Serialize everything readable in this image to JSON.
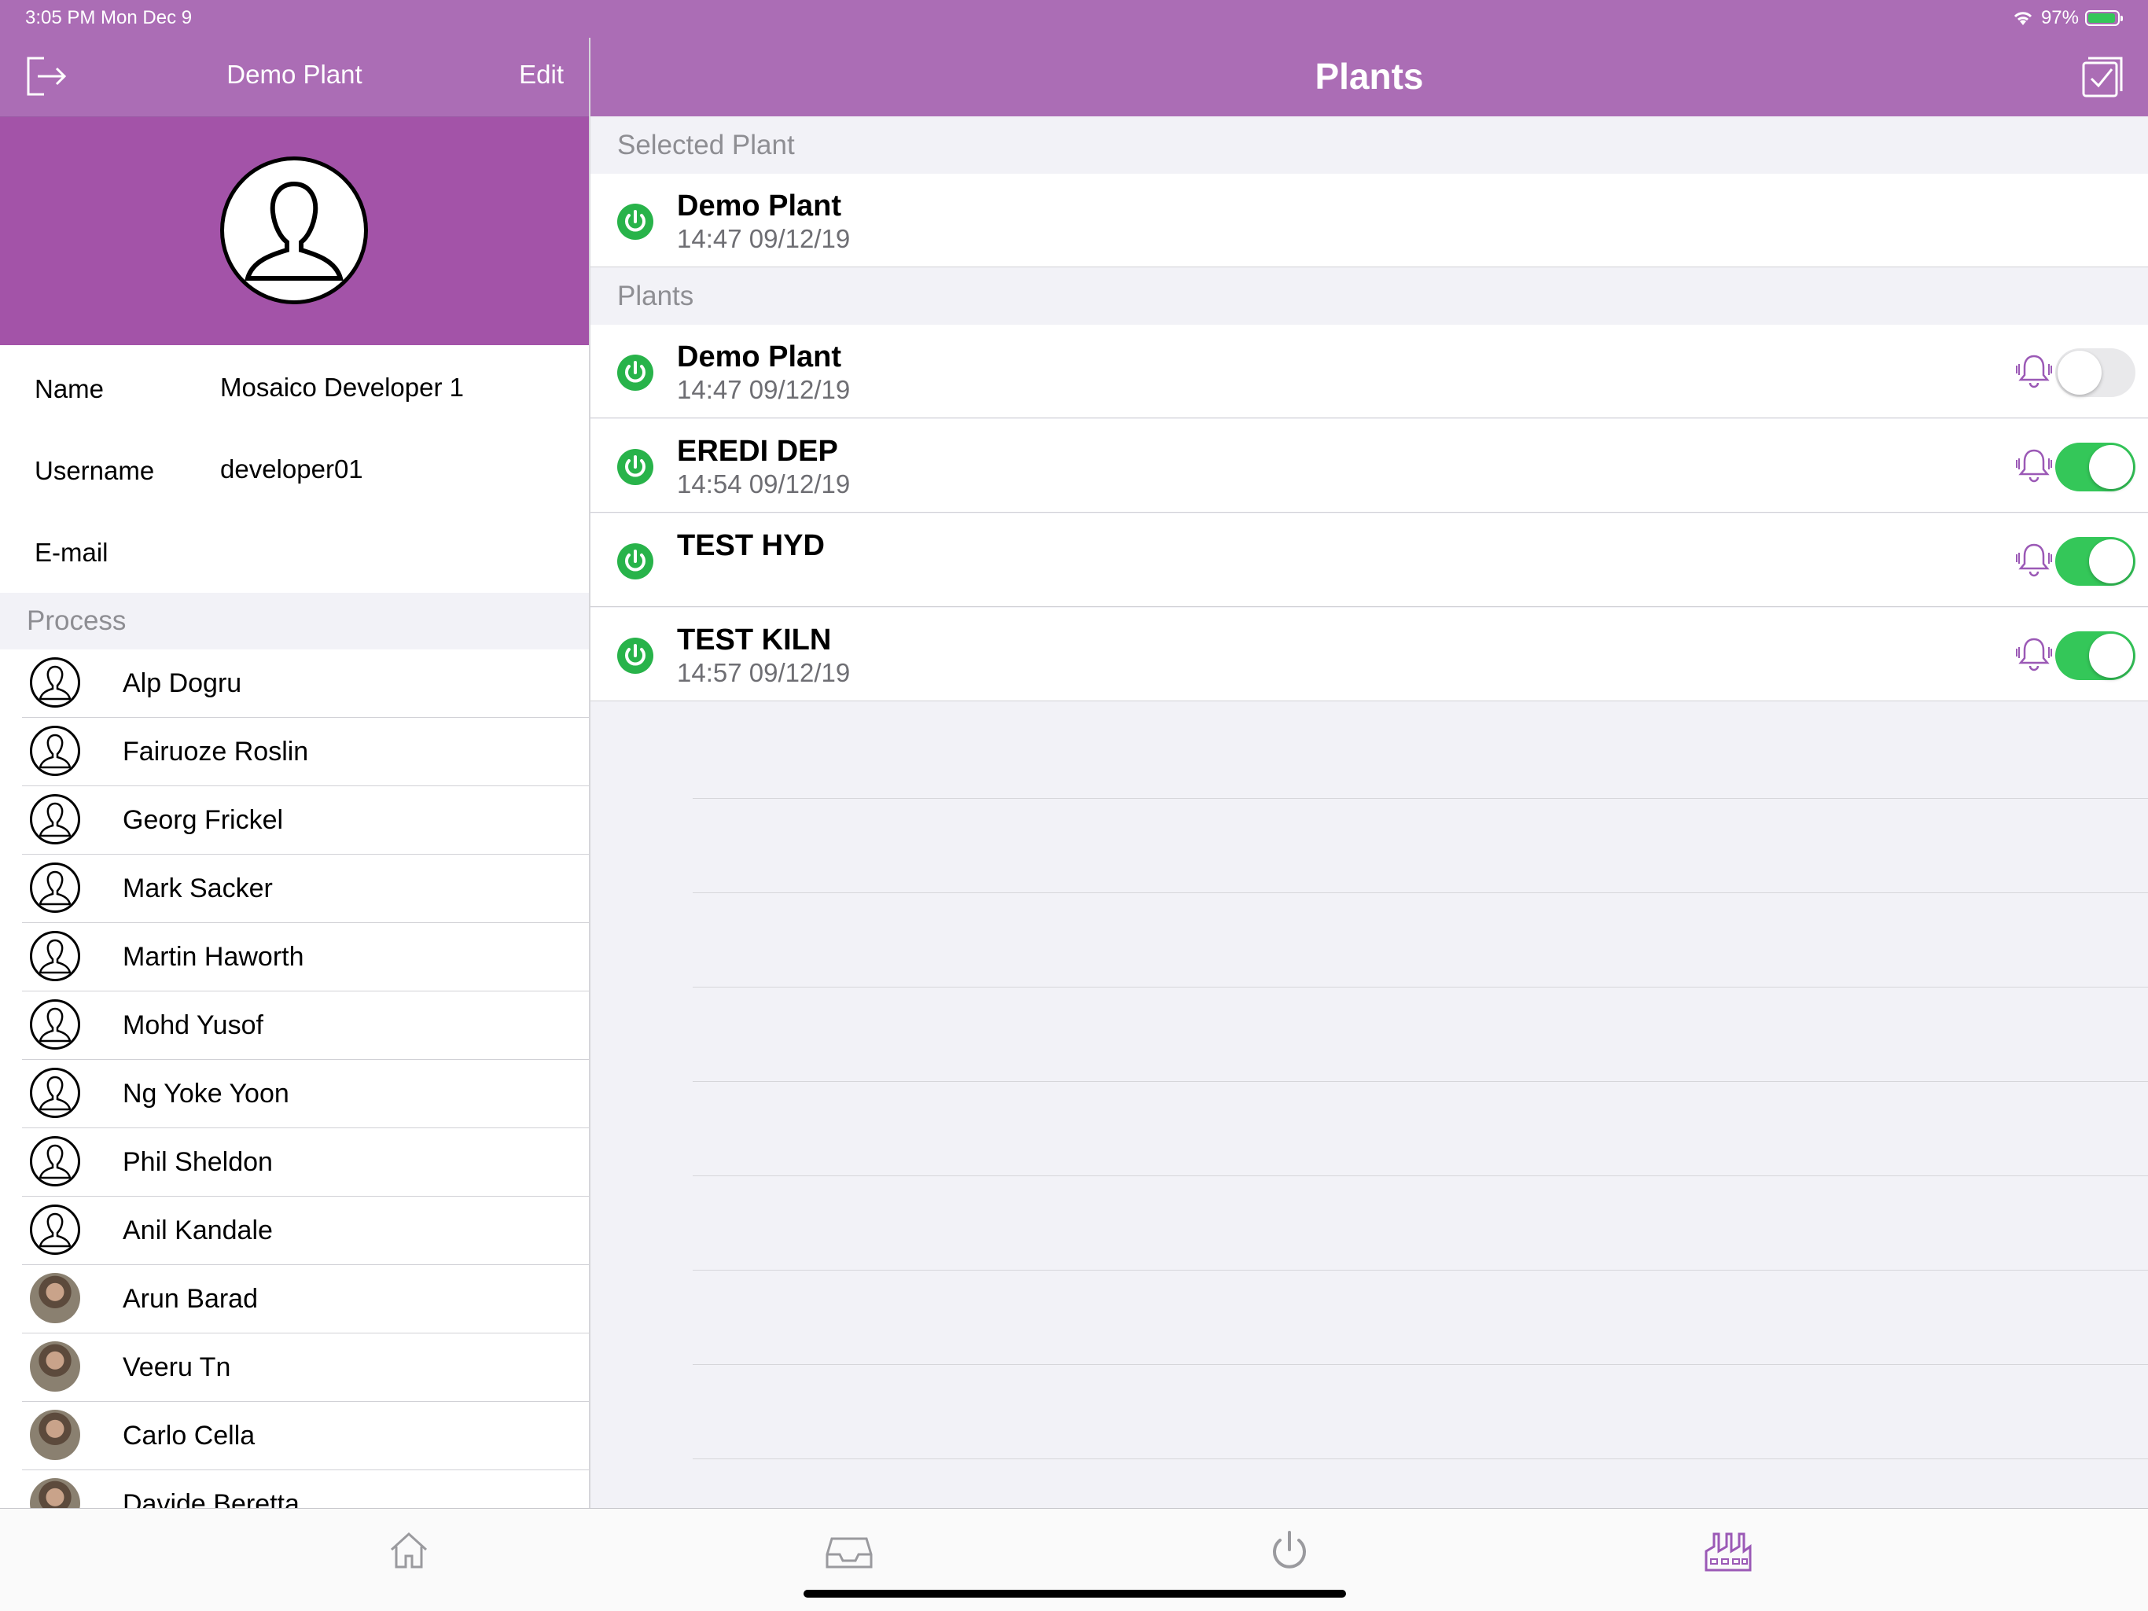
{
  "status_bar": {
    "time_date": "3:05 PM   Mon Dec 9",
    "battery": "97%"
  },
  "left_nav": {
    "title": "Demo Plant",
    "edit": "Edit"
  },
  "profile": {
    "name_label": "Name",
    "name_value": "Mosaico Developer 1",
    "username_label": "Username",
    "username_value": "developer01",
    "email_label": "E-mail",
    "email_value": ""
  },
  "process_header": "Process",
  "people": [
    {
      "name": "Alp Dogru",
      "avatar": "outline"
    },
    {
      "name": "Fairuoze Roslin",
      "avatar": "outline"
    },
    {
      "name": "Georg Frickel",
      "avatar": "outline"
    },
    {
      "name": "Mark Sacker",
      "avatar": "outline"
    },
    {
      "name": "Martin Haworth",
      "avatar": "outline"
    },
    {
      "name": "Mohd Yusof",
      "avatar": "outline"
    },
    {
      "name": "Ng Yoke Yoon",
      "avatar": "outline"
    },
    {
      "name": "Phil Sheldon",
      "avatar": "outline"
    },
    {
      "name": "Anil Kandale",
      "avatar": "outline"
    },
    {
      "name": "Arun Barad",
      "avatar": "photo"
    },
    {
      "name": "Veeru Tn",
      "avatar": "photo"
    },
    {
      "name": "Carlo Cella",
      "avatar": "photo"
    },
    {
      "name": "Davide Beretta",
      "avatar": "photo"
    }
  ],
  "right_nav": {
    "title": "Plants"
  },
  "selected_header": "Selected Plant",
  "selected_plant": {
    "name": "Demo Plant",
    "time": "14:47 09/12/19"
  },
  "plants_header": "Plants",
  "plants": [
    {
      "name": "Demo Plant",
      "time": "14:47 09/12/19",
      "notify": false
    },
    {
      "name": "EREDI DEP",
      "time": "14:54 09/12/19",
      "notify": true
    },
    {
      "name": "TEST HYD",
      "time": "",
      "notify": true
    },
    {
      "name": "TEST KILN",
      "time": "14:57 09/12/19",
      "notify": true
    }
  ],
  "tabs": [
    {
      "icon": "home-icon"
    },
    {
      "icon": "inbox-icon"
    },
    {
      "icon": "power-icon"
    },
    {
      "icon": "factory-icon",
      "active": true
    }
  ],
  "colors": {
    "nav": "#ab6db5",
    "profile_bg": "#a353a8",
    "power": "#28b34a",
    "toggle_on": "#34c759",
    "tab_active": "#9b59b6",
    "bell": "#9b59b6"
  }
}
